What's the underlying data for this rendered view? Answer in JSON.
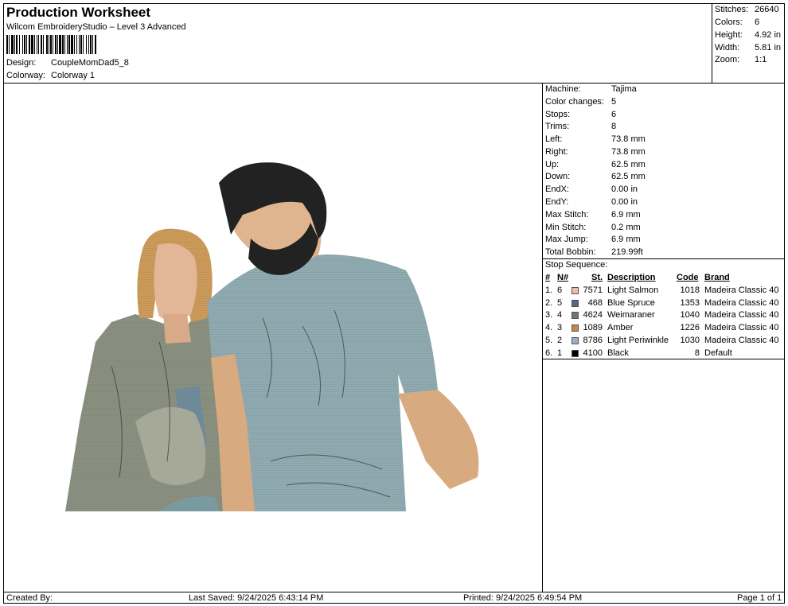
{
  "header": {
    "title": "Production Worksheet",
    "subtitle": "Wilcom EmbroideryStudio – Level 3 Advanced",
    "design_label": "Design:",
    "design_value": "CoupleMomDad5_8",
    "colorway_label": "Colorway:",
    "colorway_value": "Colorway 1"
  },
  "stats": [
    {
      "label": "Stitches:",
      "value": "26640"
    },
    {
      "label": "Colors:",
      "value": "6"
    },
    {
      "label": "Height:",
      "value": "4.92 in"
    },
    {
      "label": "Width:",
      "value": "5.81 in"
    },
    {
      "label": "Zoom:",
      "value": "1:1"
    }
  ],
  "machine_info": [
    {
      "label": "Machine:",
      "value": "Tajima"
    },
    {
      "label": "Color changes:",
      "value": "5"
    },
    {
      "label": "Stops:",
      "value": "6"
    },
    {
      "label": "Trims:",
      "value": "8"
    },
    {
      "label": "Left:",
      "value": "73.8 mm"
    },
    {
      "label": "Right:",
      "value": "73.8 mm"
    },
    {
      "label": "Up:",
      "value": "62.5 mm"
    },
    {
      "label": "Down:",
      "value": "62.5 mm"
    },
    {
      "label": "EndX:",
      "value": "0.00 in"
    },
    {
      "label": "EndY:",
      "value": "0.00 in"
    },
    {
      "label": "Max Stitch:",
      "value": "6.9 mm"
    },
    {
      "label": "Min Stitch:",
      "value": "0.2 mm"
    },
    {
      "label": "Max Jump:",
      "value": "6.9 mm"
    },
    {
      "label": "Total Bobbin:",
      "value": "219.99ft"
    }
  ],
  "stop_sequence": {
    "title": "Stop Sequence:",
    "headers": {
      "num": "#",
      "n": "N#",
      "st": "St.",
      "description": "Description",
      "code": "Code",
      "brand": "Brand"
    },
    "rows": [
      {
        "num": "1.",
        "n": "6",
        "color": "#F2B8A8",
        "st": "7571",
        "description": "Light Salmon",
        "code": "1018",
        "brand": "Madeira Classic 40"
      },
      {
        "num": "2.",
        "n": "5",
        "color": "#4F6A80",
        "st": "468",
        "description": "Blue Spruce",
        "code": "1353",
        "brand": "Madeira Classic 40"
      },
      {
        "num": "3.",
        "n": "4",
        "color": "#707576",
        "st": "4624",
        "description": "Weimaraner",
        "code": "1040",
        "brand": "Madeira Classic 40"
      },
      {
        "num": "4.",
        "n": "3",
        "color": "#C8874A",
        "st": "1089",
        "description": "Amber",
        "code": "1226",
        "brand": "Madeira Classic 40"
      },
      {
        "num": "5.",
        "n": "2",
        "color": "#9AB0C8",
        "st": "8786",
        "description": "Light Periwinkle",
        "code": "1030",
        "brand": "Madeira Classic 40"
      },
      {
        "num": "6.",
        "n": "1",
        "color": "#000000",
        "st": "4100",
        "description": "Black",
        "code": "8",
        "brand": "Default"
      }
    ]
  },
  "footer": {
    "created_by": "Created By:",
    "last_saved": "Last Saved: 9/24/2025 6:43:14 PM",
    "printed": "Printed: 9/24/2025 6:49:54 PM",
    "page": "Page 1 of 1"
  }
}
